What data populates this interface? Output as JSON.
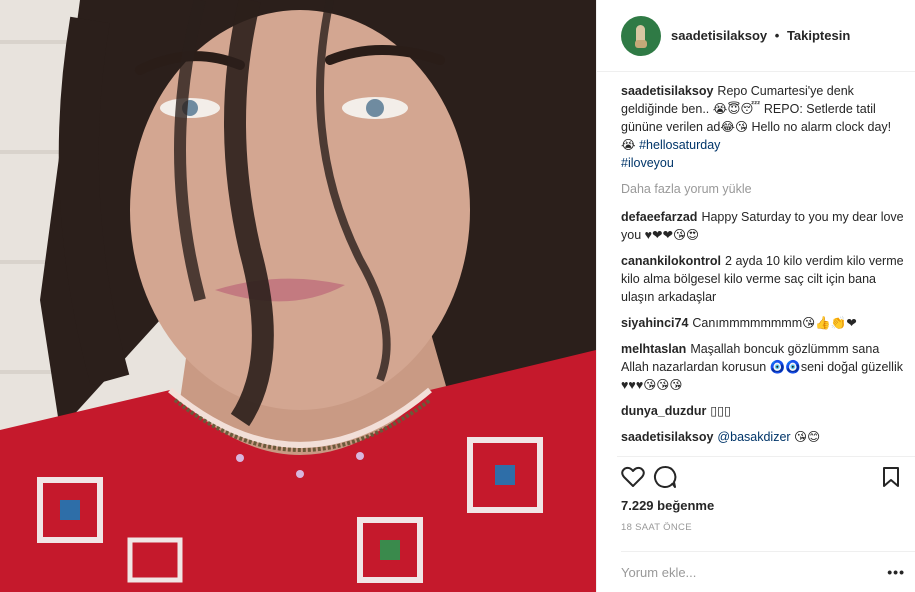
{
  "post": {
    "username": "saadetisilaksoy",
    "follow_label": "Takiptesin",
    "separator": "•"
  },
  "caption": {
    "username": "saadetisilaksoy",
    "text": "Repo Cumartesi'ye denk geldiğinde ben.. 😭😇😴 REPO: Setlerde tatil gününe verilen ad😂😘 Hello no alarm clock day! 😭",
    "tags": [
      "#hellosaturday",
      "#iloveyou"
    ]
  },
  "load_more": "Daha fazla yorum yükle",
  "comments": [
    {
      "user": "defaeefarzad",
      "text": "Happy Saturday to you my dear love you ♥❤❤😘😍"
    },
    {
      "user": "canankilokontrol",
      "text": "2 ayda 10 kilo verdim kilo verme kilo alma bölgesel kilo verme saç cilt için bana ulaşın arkadaşlar"
    },
    {
      "user": "siyahinci74",
      "text": "Canımmmmmmmm😘👍👏❤"
    },
    {
      "user": "melhtaslan",
      "text": "Maşallah boncuk gözlümmm sana Allah nazarlardan korusun 🧿🧿seni doğal güzellik ♥♥♥😘😘😘"
    },
    {
      "user": "dunya_duzdur",
      "text": "▯▯▯"
    },
    {
      "user": "saadetisilaksoy",
      "mention": "@basakdizer",
      "text": "😘😊"
    }
  ],
  "likes": "7.229 beğenme",
  "time_ago": "18 SAAT ÖNCE",
  "add_comment_placeholder": "Yorum ekle...",
  "more_label": "•••",
  "colors": {
    "accent": "#003569",
    "muted": "#999999",
    "avatar_bg": "#2f7a45"
  }
}
